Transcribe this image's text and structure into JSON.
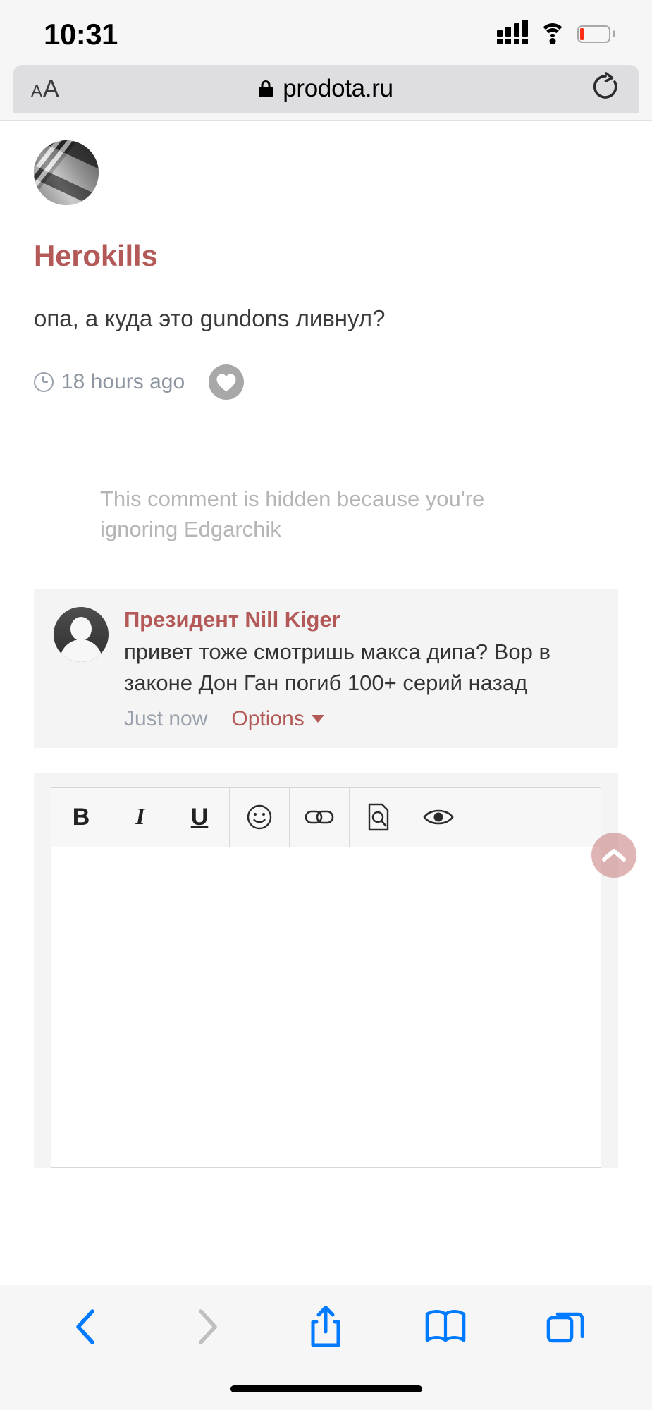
{
  "status_bar": {
    "time": "10:31",
    "signal_icon": "cellular-signal-icon",
    "wifi_icon": "wifi-icon",
    "battery_icon": "battery-low-icon",
    "battery_level_percent": 8
  },
  "browser": {
    "text_size_label_small": "A",
    "text_size_label_large": "A",
    "lock_icon": "lock-icon",
    "url": "prodota.ru",
    "reload_icon": "reload-icon"
  },
  "main_comment": {
    "avatar_icon": "user-avatar-photo",
    "username": "Herokills",
    "body": "опа, а куда это gundons ливнул?",
    "time_icon": "clock-icon",
    "timestamp": "18 hours ago",
    "like_icon": "heart-icon"
  },
  "hidden_notice": {
    "text": "This comment is hidden because you're ignoring Edgarchik"
  },
  "reply": {
    "avatar_icon": "default-user-silhouette-icon",
    "username": "Президент Nill Kiger",
    "body": "привет тоже смотришь макса дипа? Вор в законе Дон Ган погиб 100+ серий назад",
    "timestamp": "Just now",
    "options_label": "Options",
    "options_caret_icon": "caret-down-icon"
  },
  "editor": {
    "toolbar": [
      {
        "name": "bold-button",
        "label": "B",
        "style": "bold"
      },
      {
        "name": "italic-button",
        "label": "I",
        "style": "italic"
      },
      {
        "name": "underline-button",
        "label": "U",
        "style": "underline"
      },
      {
        "name": "emoji-button",
        "label": "☺",
        "style": "icon"
      },
      {
        "name": "link-button",
        "label": "🔗",
        "style": "icon"
      },
      {
        "name": "source-button",
        "label": "🔍",
        "style": "icon"
      },
      {
        "name": "preview-button",
        "label": "👁",
        "style": "icon"
      }
    ],
    "content": "",
    "placeholder": ""
  },
  "scroll_top_button": {
    "icon": "chevron-up-icon"
  },
  "bottom_bar": {
    "buttons": [
      {
        "name": "back-button",
        "icon": "chevron-left-icon",
        "enabled": true
      },
      {
        "name": "forward-button",
        "icon": "chevron-right-icon",
        "enabled": false
      },
      {
        "name": "share-button",
        "icon": "share-icon",
        "enabled": true
      },
      {
        "name": "bookmarks-button",
        "icon": "book-icon",
        "enabled": true
      },
      {
        "name": "tabs-button",
        "icon": "tabs-icon",
        "enabled": true
      }
    ]
  },
  "colors": {
    "accent_link": "#b35a58",
    "ios_blue": "#007aff",
    "muted_text": "#9aa2ad",
    "hidden_text": "#b5b5b5"
  }
}
